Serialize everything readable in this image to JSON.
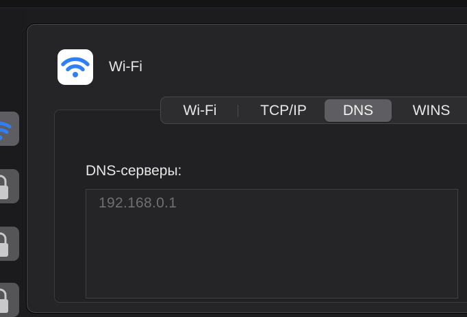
{
  "window": {
    "title": "Wi-Fi",
    "icon": "wifi-icon"
  },
  "tabs": [
    {
      "label": "Wi-Fi",
      "selected": false
    },
    {
      "label": "TCP/IP",
      "selected": false
    },
    {
      "label": "DNS",
      "selected": true
    },
    {
      "label": "WINS",
      "selected": false
    }
  ],
  "dns": {
    "label": "DNS-серверы:",
    "servers": [
      "192.168.0.1"
    ]
  },
  "sidebar": {
    "icons": [
      "wifi-icon",
      "lock-icon",
      "lock-icon",
      "lock-icon"
    ]
  },
  "colors": {
    "accent_blue": "#2f7ff6",
    "selected_tab": "#5e5e62",
    "background": "#1c1c1e"
  }
}
